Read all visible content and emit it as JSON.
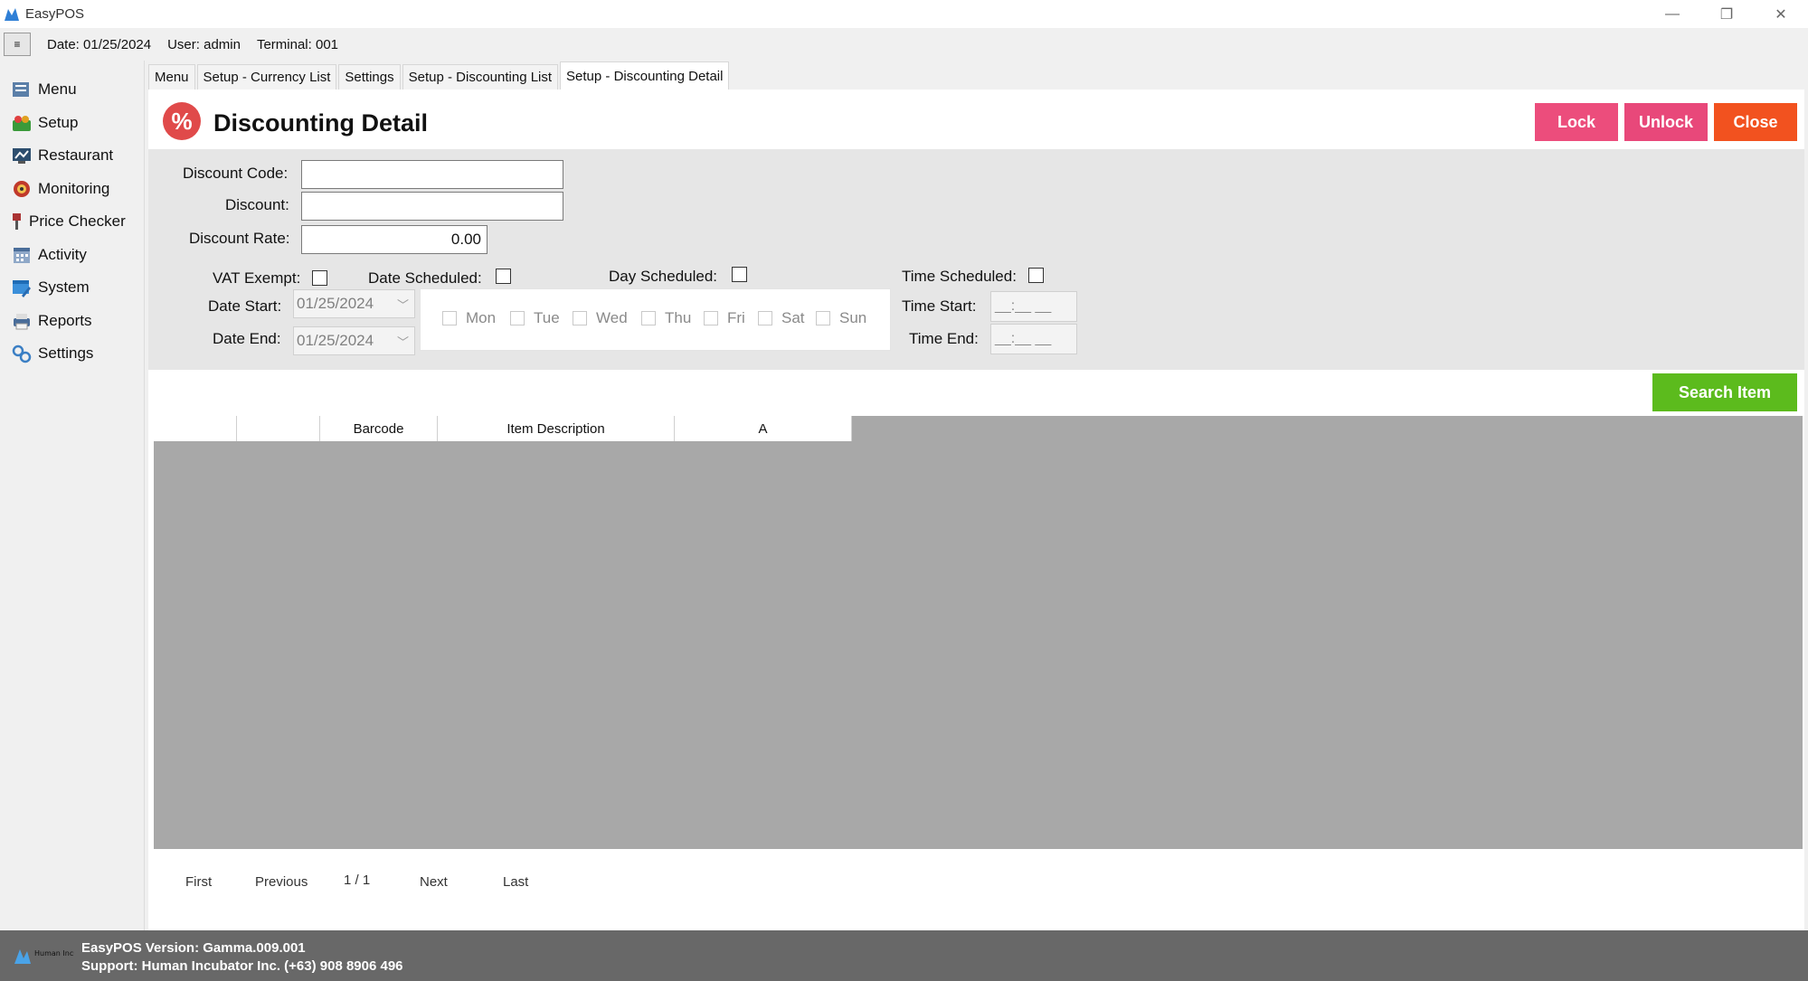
{
  "window": {
    "title": "EasyPOS",
    "minimize_glyph": "—",
    "restore_glyph": "❐",
    "close_glyph": "✕"
  },
  "infobar": {
    "menu_glyph": "≡",
    "date": "Date: 01/25/2024",
    "user": "User: admin",
    "terminal": "Terminal: 001"
  },
  "sidebar": {
    "items": [
      {
        "label": "Menu",
        "icon": "menu-icon"
      },
      {
        "label": "Setup",
        "icon": "setup-icon"
      },
      {
        "label": "Restaurant",
        "icon": "restaurant-icon"
      },
      {
        "label": "Monitoring",
        "icon": "monitoring-icon"
      },
      {
        "label": "Price Checker",
        "icon": "price-checker-icon"
      },
      {
        "label": "Activity",
        "icon": "activity-icon"
      },
      {
        "label": "System",
        "icon": "system-icon"
      },
      {
        "label": "Reports",
        "icon": "reports-icon"
      },
      {
        "label": "Settings",
        "icon": "settings-icon"
      }
    ]
  },
  "tabs": [
    {
      "label": "Menu"
    },
    {
      "label": "Setup - Currency List"
    },
    {
      "label": "Settings"
    },
    {
      "label": "Setup - Discounting List"
    },
    {
      "label": "Setup - Discounting Detail",
      "active": true
    }
  ],
  "header": {
    "icon_glyph": "%",
    "title": "Discounting Detail"
  },
  "actions": {
    "lock": "Lock",
    "unlock": "Unlock",
    "close": "Close",
    "search_item": "Search Item"
  },
  "form": {
    "discount_code_label": "Discount Code:",
    "discount_code_value": "",
    "discount_label": "Discount:",
    "discount_value": "",
    "discount_rate_label": "Discount Rate:",
    "discount_rate_value": "0.00",
    "vat_exempt_label": "VAT Exempt:",
    "date_scheduled_label": "Date Scheduled:",
    "day_scheduled_label": "Day Scheduled:",
    "time_scheduled_label": "Time Scheduled:",
    "date_start_label": "Date Start:",
    "date_start_value": "01/25/2024",
    "date_end_label": "Date End:",
    "date_end_value": "01/25/2024",
    "time_start_label": "Time Start:",
    "time_start_value": "__:__ __",
    "time_end_label": "Time End:",
    "time_end_value": "__:__ __",
    "days": [
      "Mon",
      "Tue",
      "Wed",
      "Thu",
      "Fri",
      "Sat",
      "Sun"
    ]
  },
  "grid": {
    "columns": [
      "",
      "",
      "Barcode",
      "Item Description",
      "A"
    ]
  },
  "pager": {
    "first": "First",
    "previous": "Previous",
    "page": "1 / 1",
    "next": "Next",
    "last": "Last"
  },
  "footer": {
    "version": "EasyPOS Version: Gamma.009.001",
    "support": "Support: Human Incubator Inc. (+63) 908 8906 496",
    "logo_text": "Human Incubator"
  }
}
